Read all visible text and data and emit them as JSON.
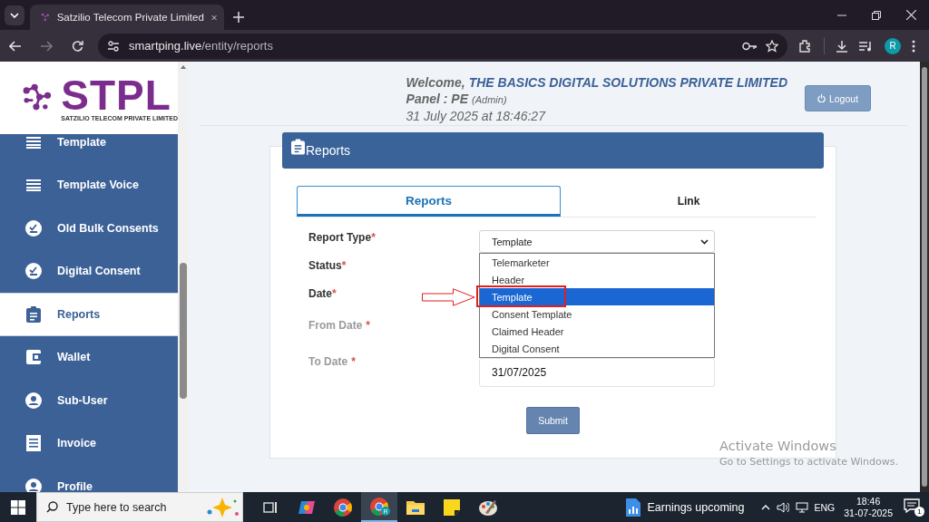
{
  "browser": {
    "tabs": [
      {
        "title": "Satzilio Telecom Private Limited",
        "selected": true
      }
    ],
    "url_host": "smartping.live",
    "url_path": "/entity/reports",
    "profile": "R"
  },
  "logo": {
    "text": "STPL",
    "tagline": "SATZILIO TELECOM PRIVATE LIMITED"
  },
  "sidebar": {
    "items": [
      {
        "label": "Template",
        "kind": "lines",
        "selected": false
      },
      {
        "label": "Template Voice",
        "kind": "lines",
        "selected": false
      },
      {
        "label": "Old Bulk Consents",
        "kind": "check",
        "selected": false
      },
      {
        "label": "Digital Consent",
        "kind": "check",
        "selected": false
      },
      {
        "label": "Reports",
        "kind": "clipboard",
        "selected": true
      },
      {
        "label": "Wallet",
        "kind": "wallet",
        "selected": false
      },
      {
        "label": "Sub-User",
        "kind": "person",
        "selected": false
      },
      {
        "label": "Invoice",
        "kind": "invoice",
        "selected": false
      },
      {
        "label": "Profile",
        "kind": "person",
        "selected": false
      }
    ]
  },
  "header": {
    "welcome": "Welcome,",
    "organization": "THE BASICS DIGITAL SOLUTIONS PRIVATE LIMITED",
    "panel": "Panel : PE",
    "role": "(Admin)",
    "datetime": "31 July 2025 at 18:46:27",
    "logout": "Logout"
  },
  "card": {
    "title": "Reports",
    "tabs": [
      {
        "label": "Reports",
        "selected": true
      },
      {
        "label": "Link",
        "selected": false
      }
    ],
    "fields": [
      {
        "label": "Report Type",
        "mark": "*",
        "disabled": false
      },
      {
        "label": "Status",
        "mark": "*",
        "disabled": false
      },
      {
        "label": "Date",
        "mark": "*",
        "disabled": false
      },
      {
        "label": "From Date",
        "mark": "*",
        "disabled": true
      },
      {
        "label": "To Date",
        "mark": "*",
        "disabled": true
      }
    ],
    "report_type": {
      "value": "Template",
      "options": [
        {
          "label": "Telemarketer",
          "selected": false,
          "annotated": false
        },
        {
          "label": "Header",
          "selected": false,
          "annotated": false
        },
        {
          "label": "Template",
          "selected": true,
          "annotated": true
        },
        {
          "label": "Consent Template",
          "selected": false,
          "annotated": false
        },
        {
          "label": "Claimed Header",
          "selected": false,
          "annotated": false
        },
        {
          "label": "Digital Consent",
          "selected": false,
          "annotated": false
        }
      ]
    },
    "to_date": "31/07/2025",
    "submit": "Submit"
  },
  "activation": {
    "title": "Activate Windows",
    "hint": "Go to Settings to activate Windows."
  },
  "taskbar": {
    "search_placeholder": "Type here to search",
    "apps": [
      {
        "kind": "taskview",
        "selected": false
      },
      {
        "kind": "copilot",
        "selected": false
      },
      {
        "kind": "chrome",
        "selected": false
      },
      {
        "kind": "chrome-profile",
        "badge": "R",
        "selected": true
      },
      {
        "kind": "explorer",
        "selected": false
      },
      {
        "kind": "sticky",
        "selected": false
      },
      {
        "kind": "paint",
        "selected": false
      }
    ],
    "news": "Earnings upcoming",
    "language": "ENG",
    "time": "18:46",
    "date": "31-07-2025",
    "notifications": "1"
  }
}
